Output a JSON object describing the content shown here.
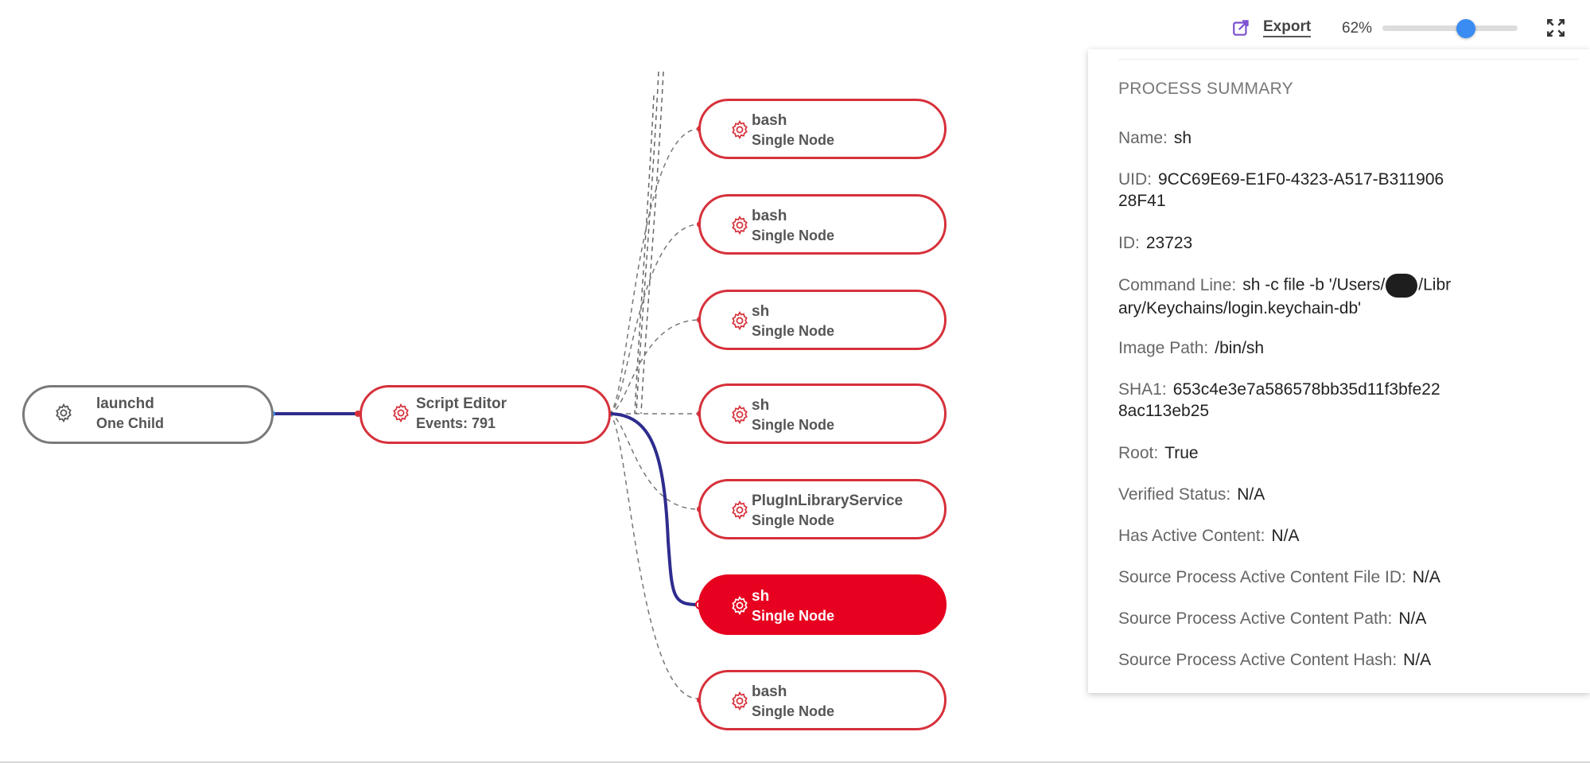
{
  "toolbar": {
    "export_label": "Export",
    "zoom_value": "62%",
    "zoom_fraction": 0.62,
    "icons": [
      "export-icon",
      "fullscreen-icon"
    ],
    "accent_color": "#3a8cf2"
  },
  "colors": {
    "node_border": "#d6313b",
    "node_active": "#e7001f",
    "edge_active": "#2e2c8e",
    "root_border": "#7a7a7a"
  },
  "graph": {
    "root": {
      "name": "launchd",
      "sub": "One Child"
    },
    "parent": {
      "name": "Script Editor",
      "sub": "Events: 791"
    },
    "children": [
      {
        "name": "bash",
        "sub": "Single Node"
      },
      {
        "name": "bash",
        "sub": "Single Node"
      },
      {
        "name": "sh",
        "sub": "Single Node"
      },
      {
        "name": "sh",
        "sub": "Single Node"
      },
      {
        "name": "PlugInLibraryService",
        "sub": "Single Node"
      },
      {
        "name": "sh",
        "sub": "Single Node",
        "active": true
      },
      {
        "name": "bash",
        "sub": "Single Node"
      }
    ]
  },
  "summary": {
    "title": "PROCESS SUMMARY",
    "name_label": "Name:",
    "name_value": "sh",
    "uid_label": "UID:",
    "uid_value_1": "9CC69E69-E1F0-4323-A517-B311906",
    "uid_value_2": "28F41",
    "id_label": "ID:",
    "id_value": "23723",
    "cmd_label": "Command Line:",
    "cmd_value_1a": "sh -c file -b '/Users/",
    "cmd_value_1b": "/Libr",
    "cmd_value_2": "ary/Keychains/login.keychain-db'",
    "image_label": "Image Path:",
    "image_value": "/bin/sh",
    "sha1_label": "SHA1:",
    "sha1_value_1": "653c4e3e7a586578bb35d11f3bfe22",
    "sha1_value_2": "8ac113eb25",
    "root_label": "Root:",
    "root_value": "True",
    "verified_label": "Verified Status:",
    "verified_value": "N/A",
    "active_label": "Has Active Content:",
    "active_value": "N/A",
    "src_file_label": "Source Process Active Content File ID:",
    "src_file_value": "N/A",
    "src_path_label": "Source Process Active Content Path:",
    "src_path_value": "N/A",
    "src_hash_label": "Source Process Active Content Hash:",
    "src_hash_value": "N/A"
  }
}
